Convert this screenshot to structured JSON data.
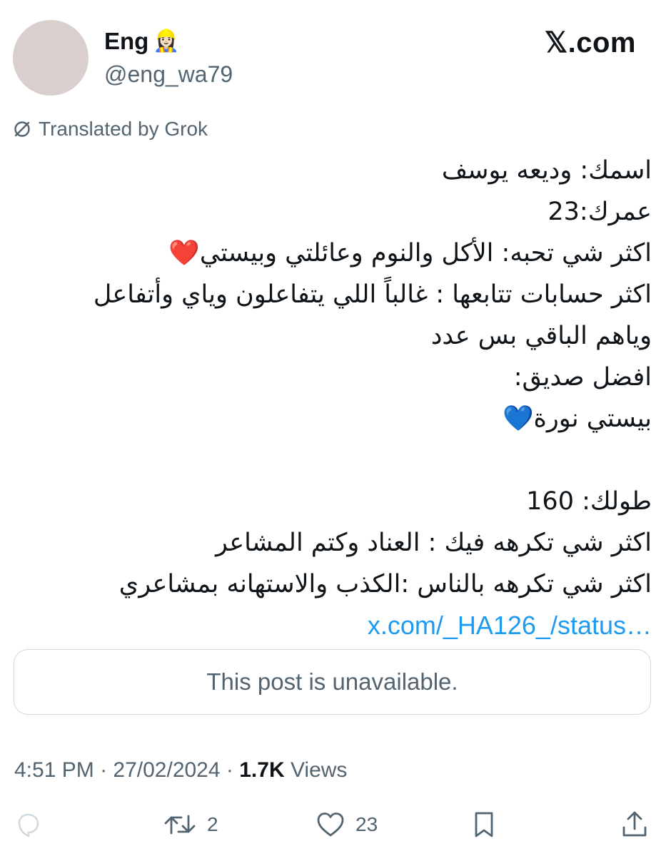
{
  "author": {
    "display_name": "Eng",
    "name_emoji": "👷🏻‍♀️",
    "handle": "@eng_wa79"
  },
  "site": {
    "logo_text": "𝕏.com"
  },
  "translation": {
    "label": "Translated by Grok",
    "icon": "translate-icon"
  },
  "tweet": {
    "lines": [
      "اسمك: وديعه يوسف",
      "عمرك:23",
      "اكثر شي تحبه: الأكل والنوم وعائلتي وبيستي❤️",
      "اكثر حسابات تتابعها : غالباً اللي يتفاعلون وياي وأتفاعل",
      "وياهم الباقي بس عدد",
      "افضل صديق:",
      "بيستي نورة💙",
      "",
      "طولك: 160",
      "اكثر شي تكرهه فيك : العناد وكتم المشاعر",
      "اكثر شي تكرهه بالناس :الكذب والاستهانه بمشاعري"
    ],
    "link_text": "x.com/_HA126_/status…"
  },
  "quoted_post": {
    "message": "This post is unavailable."
  },
  "meta": {
    "time": "4:51 PM",
    "separator": " · ",
    "date": "27/02/2024",
    "views_count": "1.7K",
    "views_label": " Views"
  },
  "actions": {
    "reply": {
      "icon": "reply-icon",
      "count": ""
    },
    "repost": {
      "icon": "repost-icon",
      "count": "2"
    },
    "like": {
      "icon": "heart-icon",
      "count": "23"
    },
    "bookmark": {
      "icon": "bookmark-icon"
    },
    "share": {
      "icon": "share-icon"
    }
  },
  "colors": {
    "text_primary": "#0f1419",
    "text_secondary": "#536471",
    "link": "#1d9bf0",
    "border": "#cfd9de",
    "avatar_placeholder": "#d9d0cd"
  }
}
